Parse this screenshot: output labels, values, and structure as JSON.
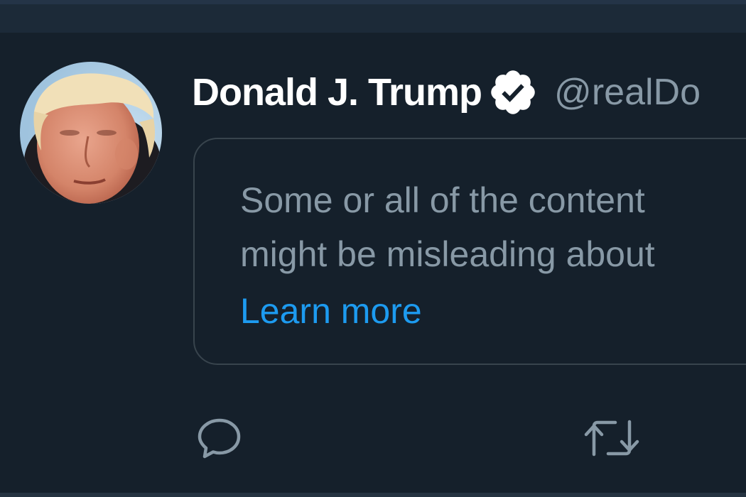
{
  "tweet": {
    "author": {
      "display_name": "Donald J. Trump",
      "handle": "@realDo",
      "verified": true
    },
    "notice": {
      "line1": "Some or all of the content",
      "line2": "might be misleading about",
      "link_label": "Learn more"
    },
    "actions": {
      "reply_icon": "reply-icon",
      "retweet_icon": "retweet-icon"
    }
  },
  "colors": {
    "background": "#15202b",
    "top_bar": "#1c2a38",
    "display_name": "#ffffff",
    "secondary_text": "#8899a6",
    "link": "#1d9bf0",
    "border": "#38444d"
  }
}
